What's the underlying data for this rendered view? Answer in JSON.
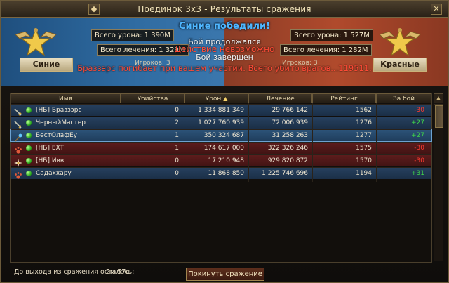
{
  "window": {
    "title": "Поединок 3x3 - Результаты сражения",
    "left_button": "◆",
    "close_button": "✕"
  },
  "banner": {
    "victory": "Синие победили!",
    "notices": [
      "Бой продолжался",
      "Действие невозможно",
      "Бой завершен",
      "Браззэрс погибает при вашем участии. Всего убито врагов...119511."
    ],
    "blue": {
      "team_name": "Синие",
      "damage_label": "Всего урона: 1 390М",
      "healing_label": "Всего лечения: 1 329М",
      "players_label": "Игроков: 3",
      "color": "#2e6aa0"
    },
    "red": {
      "team_name": "Красные",
      "damage_label": "Всего урона: 1 527М",
      "healing_label": "Всего лечения: 1 282М",
      "players_label": "Игроков: 3",
      "color": "#b04a2c"
    }
  },
  "table": {
    "headers": {
      "name": "Имя",
      "kills": "Убийства",
      "damage": "Урон",
      "healing": "Лечение",
      "rating": "Рейтинг",
      "per_battle": "За бой"
    },
    "sort_indicator": "▲",
    "rows": [
      {
        "team": "blue",
        "class_icon": "sword-icon",
        "name": "[НБ] Браззэрс",
        "kills": "0",
        "damage": "1 334 881 349",
        "healing": "29 766 142",
        "rating": "1562",
        "delta": "-30",
        "delta_type": "neg"
      },
      {
        "team": "blue",
        "class_icon": "sword-icon",
        "name": "ЧерныйМастер",
        "kills": "2",
        "damage": "1 027 760 939",
        "healing": "72 006 939",
        "rating": "1276",
        "delta": "+27",
        "delta_type": "pos"
      },
      {
        "team": "blue",
        "class_icon": "staff-icon",
        "name": "БестОлафЕу",
        "kills": "1",
        "damage": "350 324 687",
        "healing": "31 258 263",
        "rating": "1277",
        "delta": "+27",
        "delta_type": "pos",
        "self": true
      },
      {
        "team": "red",
        "class_icon": "paw-icon",
        "name": "[НБ] EXT",
        "kills": "1",
        "damage": "174 617 000",
        "healing": "322 326 246",
        "rating": "1575",
        "delta": "-30",
        "delta_type": "neg"
      },
      {
        "team": "red",
        "class_icon": "cross-icon",
        "name": "[НБ] Ивв",
        "kills": "0",
        "damage": "17 210 948",
        "healing": "929 820 872",
        "rating": "1570",
        "delta": "-30",
        "delta_type": "neg"
      },
      {
        "team": "blue",
        "class_icon": "paw-icon",
        "name": "Садаххару",
        "kills": "0",
        "damage": "11 868 850",
        "healing": "1 225 746 696",
        "rating": "1194",
        "delta": "+31",
        "delta_type": "pos"
      }
    ]
  },
  "footer": {
    "time_left_label": "До выхода из сражения осталось:",
    "time_left_value": "2м 57с",
    "leave_button": "Покинуть сражение"
  }
}
